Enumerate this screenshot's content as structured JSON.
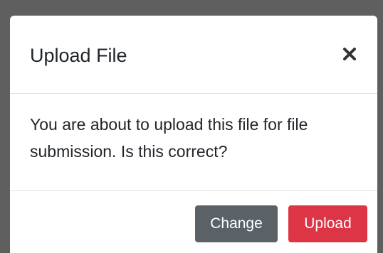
{
  "modal": {
    "title": "Upload File",
    "close_icon": "close-x-icon",
    "body_text": "You are about to upload this file for file submission. Is this correct?",
    "buttons": {
      "change_label": "Change",
      "upload_label": "Upload"
    }
  },
  "colors": {
    "backdrop": "#5f5f5f",
    "change_button": "#5a6268",
    "upload_button": "#dc3545",
    "text": "#212529"
  }
}
